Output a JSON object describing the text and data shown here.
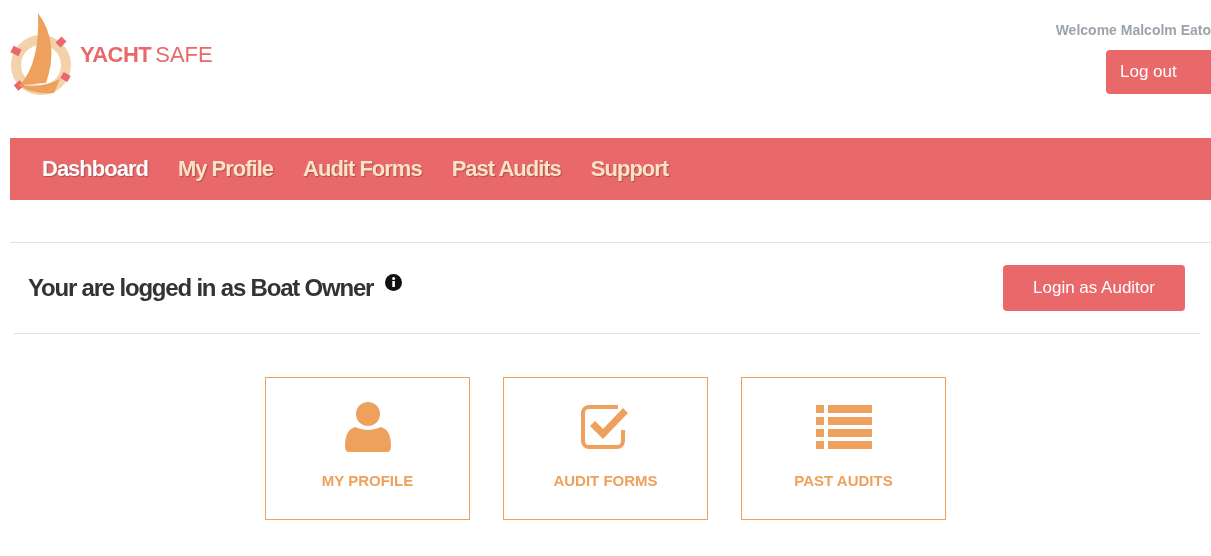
{
  "header": {
    "brand": {
      "strong": "YACHT",
      "light": "SAFE"
    },
    "welcome": "Welcome Malcolm Eato",
    "logout": "Log out"
  },
  "nav": [
    {
      "label": "Dashboard",
      "selected": true
    },
    {
      "label": "My Profile",
      "selected": false
    },
    {
      "label": "Audit Forms",
      "selected": false
    },
    {
      "label": "Past Audits",
      "selected": false
    },
    {
      "label": "Support",
      "selected": false
    }
  ],
  "role_bar": {
    "text": "Your are logged in as Boat Owner",
    "button": "Login as Auditor"
  },
  "tiles": [
    {
      "kind": "profile",
      "label": "MY PROFILE"
    },
    {
      "kind": "checklist",
      "label": "AUDIT FORMS"
    },
    {
      "kind": "list",
      "label": "PAST AUDITS"
    }
  ]
}
